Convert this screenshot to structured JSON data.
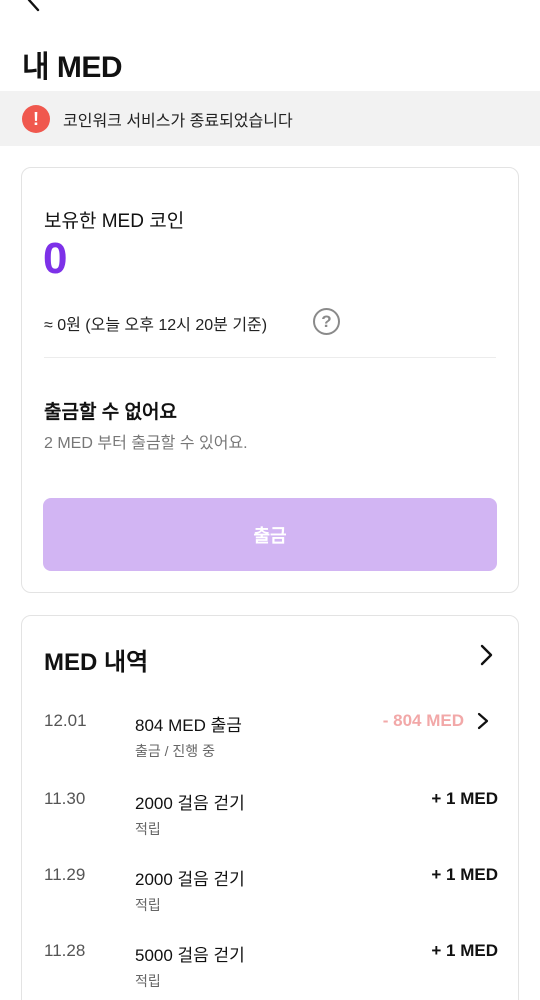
{
  "header": {
    "title": "내 MED"
  },
  "notice": {
    "text": "코인워크 서비스가 종료되었습니다",
    "icon": "alert-icon",
    "color": "#f0584e"
  },
  "balance": {
    "label": "보유한 MED 코인",
    "value": "0",
    "rate": "≈ 0원 (오늘 오후 12시 20분 기준)",
    "accent": "#7d31e8"
  },
  "withdraw": {
    "title": "출금할 수 없어요",
    "subtitle": "2 MED 부터 출금할 수 있어요.",
    "button_label": "출금",
    "button_color": "#d2b5f3"
  },
  "history": {
    "title": "MED 내역",
    "rows": [
      {
        "date": "12.01",
        "title": "804 MED 출금",
        "sub": "출금 / 진행 중",
        "amount": "- 804 MED"
      },
      {
        "date": "11.30",
        "title": "2000 걸음 걷기",
        "sub": "적립",
        "amount": "+ 1 MED"
      },
      {
        "date": "11.29",
        "title": "2000 걸음 걷기",
        "sub": "적립",
        "amount": "+ 1 MED"
      },
      {
        "date": "11.28",
        "title": "5000 걸음 걷기",
        "sub": "적립",
        "amount": "+ 1 MED"
      }
    ]
  }
}
